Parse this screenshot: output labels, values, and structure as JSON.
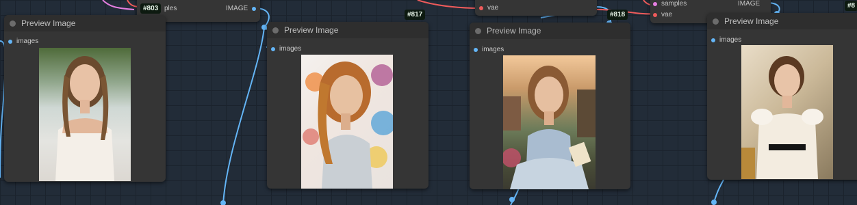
{
  "nodes": [
    {
      "id": "#803",
      "title": "Preview Image",
      "input": "images"
    },
    {
      "id": "#817",
      "title": "Preview Image",
      "input": "images"
    },
    {
      "id": "#818",
      "title": "Preview Image",
      "input": "images"
    },
    {
      "id": "#8",
      "title": "Preview Image",
      "input": "images"
    }
  ],
  "partial_nodes": {
    "left_top": {
      "input_label": "ples",
      "output_label": "IMAGE"
    },
    "mid_top": {
      "input_label": "vae"
    },
    "right_top": {
      "input_samples": "samples",
      "input_vae": "vae",
      "output_label": "IMAGE"
    }
  },
  "colors": {
    "canvas": "#222c38",
    "node": "#353535",
    "wire_image": "#64b5f6",
    "wire_vae": "#ef5b5b",
    "wire_latent": "#e57ee0"
  }
}
